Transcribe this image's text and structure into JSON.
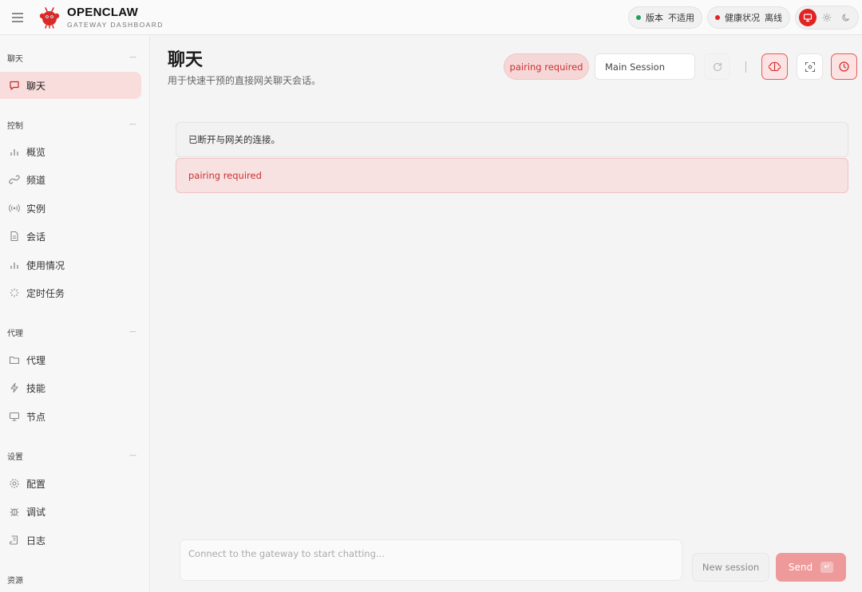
{
  "header": {
    "brand_name": "OPENCLAW",
    "brand_sub": "GATEWAY DASHBOARD",
    "version_label": "版本",
    "version_value": "不适用",
    "health_label": "健康状况",
    "health_value": "离线",
    "colors": {
      "ok": "#22a05a",
      "error": "#e02424"
    }
  },
  "sidebar": {
    "sections": [
      {
        "title": "聊天",
        "items": [
          {
            "label": "聊天",
            "icon": "chat-icon",
            "active": true
          }
        ]
      },
      {
        "title": "控制",
        "items": [
          {
            "label": "概览",
            "icon": "bar-chart-icon"
          },
          {
            "label": "频道",
            "icon": "link-icon"
          },
          {
            "label": "实例",
            "icon": "broadcast-icon"
          },
          {
            "label": "会话",
            "icon": "document-icon"
          },
          {
            "label": "使用情况",
            "icon": "bar-chart-icon"
          },
          {
            "label": "定时任务",
            "icon": "loader-icon"
          }
        ]
      },
      {
        "title": "代理",
        "items": [
          {
            "label": "代理",
            "icon": "folder-icon"
          },
          {
            "label": "技能",
            "icon": "bolt-icon"
          },
          {
            "label": "节点",
            "icon": "monitor-icon"
          }
        ]
      },
      {
        "title": "设置",
        "items": [
          {
            "label": "配置",
            "icon": "gear-icon"
          },
          {
            "label": "调试",
            "icon": "bug-icon"
          },
          {
            "label": "日志",
            "icon": "scroll-icon"
          }
        ]
      },
      {
        "title": "资源",
        "items": []
      }
    ]
  },
  "main": {
    "title": "聊天",
    "subtitle": "用于快速干预的直接网关聊天会话。",
    "pairing_badge": "pairing required",
    "session_select": "Main Session",
    "messages": [
      {
        "text": "已断开与网关的连接。",
        "kind": "info"
      },
      {
        "text": "pairing required",
        "kind": "error"
      }
    ],
    "composer_placeholder": "Connect to the gateway to start chatting...",
    "new_session_label": "New session",
    "send_label": "Send",
    "send_shortcut": "↵"
  }
}
